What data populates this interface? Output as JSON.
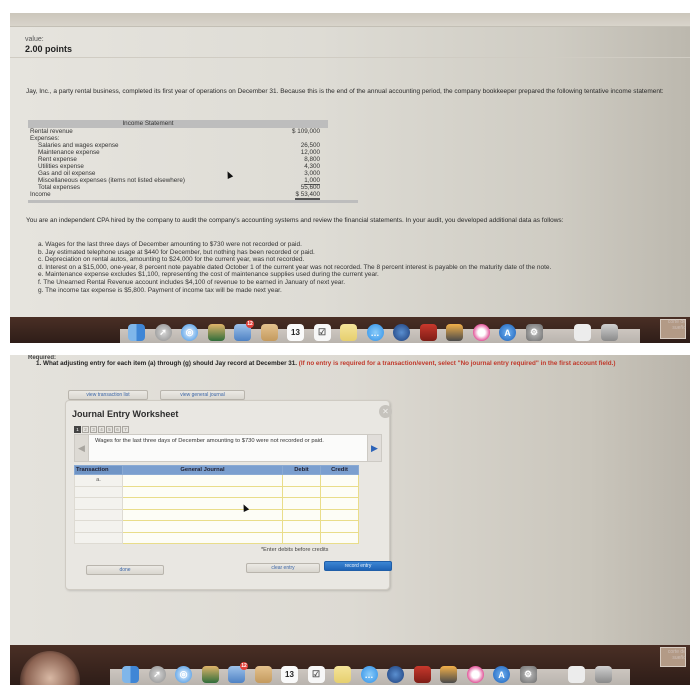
{
  "top_screen": {
    "value_label": "value:",
    "points": "2.00 points",
    "intro": "Jay, Inc., a party rental business, completed its first year of operations on December 31. Because this is the end of the annual accounting period, the company bookkeeper prepared the following tentative income statement:",
    "income_statement": {
      "title": "Income Statement",
      "rows": [
        {
          "label": "Rental revenue",
          "amount": "$ 109,000",
          "indent": false,
          "style": ""
        },
        {
          "label": "Expenses:",
          "amount": "",
          "indent": false,
          "style": ""
        },
        {
          "label": "Salaries and wages expense",
          "amount": "26,500",
          "indent": true,
          "style": ""
        },
        {
          "label": "Maintenance expense",
          "amount": "12,000",
          "indent": true,
          "style": ""
        },
        {
          "label": "Rent expense",
          "amount": "8,800",
          "indent": true,
          "style": ""
        },
        {
          "label": "Utilities expense",
          "amount": "4,300",
          "indent": true,
          "style": ""
        },
        {
          "label": "Gas and oil expense",
          "amount": "3,000",
          "indent": true,
          "style": ""
        },
        {
          "label": "Miscellaneous expenses (items not listed elsewhere)",
          "amount": "1,000",
          "indent": true,
          "style": "ul"
        },
        {
          "label": "Total expenses",
          "amount": "55,600",
          "indent": true,
          "style": ""
        },
        {
          "label": "Income",
          "amount": "$   53,400",
          "indent": false,
          "style": "dul"
        }
      ]
    },
    "cpa_text": "You are an independent CPA hired by the company to audit the company's accounting systems and review the financial statements. In your audit, you developed additional data as follows:",
    "items": [
      "a.  Wages for the last three days of December amounting to $730 were not recorded or paid.",
      "b.  Jay estimated telephone usage at $440 for December, but nothing has been recorded or paid.",
      "c.  Depreciation on rental autos, amounting to $24,000 for the current year, was not recorded.",
      "d.  Interest on a $15,000, one-year, 8 percent note payable dated October 1 of the current year was not recorded. The 8 percent interest is payable on the maturity date of the note.",
      "e.  Maintenance expense excludes $1,100, representing the cost of maintenance supplies used during the current year.",
      "f.  The Unearned Rental Revenue account includes $4,100 of revenue to be earned in January of next year.",
      "g.  The income tax expense is $5,800. Payment of income tax will be made next year."
    ]
  },
  "bottom_screen": {
    "required_label": "Required:",
    "question_prefix": "1. What adjusting entry for each item (a) through (g) should Jay record at December 31.",
    "question_note": "(If no entry is required for a transaction/event, select \"No journal entry required\" in the first account field.)",
    "buttons": {
      "view_transaction_list": "view transaction list",
      "view_general_journal": "view general journal",
      "done": "done",
      "clear_entry": "clear entry",
      "record_entry": "record entry"
    },
    "worksheet": {
      "title": "Journal Entry Worksheet",
      "steps": [
        "1",
        "2",
        "3",
        "4",
        "5",
        "6",
        "7"
      ],
      "active_step": "1",
      "description": "Wages for the last three days of December amounting to $730 were not recorded or paid.",
      "columns": [
        "Transaction",
        "General Journal",
        "Debit",
        "Credit"
      ],
      "rows": [
        {
          "transaction": "a.",
          "account": "",
          "debit": "",
          "credit": ""
        },
        {
          "transaction": "",
          "account": "",
          "debit": "",
          "credit": ""
        },
        {
          "transaction": "",
          "account": "",
          "debit": "",
          "credit": ""
        },
        {
          "transaction": "",
          "account": "",
          "debit": "",
          "credit": ""
        },
        {
          "transaction": "",
          "account": "",
          "debit": "",
          "credit": ""
        },
        {
          "transaction": "",
          "account": "",
          "debit": "",
          "credit": ""
        }
      ],
      "note": "*Enter debits before credits"
    }
  },
  "dock": {
    "icons": [
      "finder",
      "launchpad",
      "safari",
      "image-capture",
      "mail",
      "contacts",
      "calendar",
      "reminders",
      "notes",
      "messages",
      "facetime",
      "photo-booth",
      "iphoto",
      "itunes",
      "app-store",
      "system-preferences",
      "downloads",
      "trash"
    ],
    "calendar_day": "13",
    "mail_badge": "12",
    "desktop_label_line1": "corte de",
    "desktop_label_line2": "sueño"
  },
  "colors": {
    "accent_blue": "#1e63b5",
    "table_header": "#7b9fcf",
    "instruction_red": "#c0392b",
    "dock_shelf": "#3a2620"
  }
}
